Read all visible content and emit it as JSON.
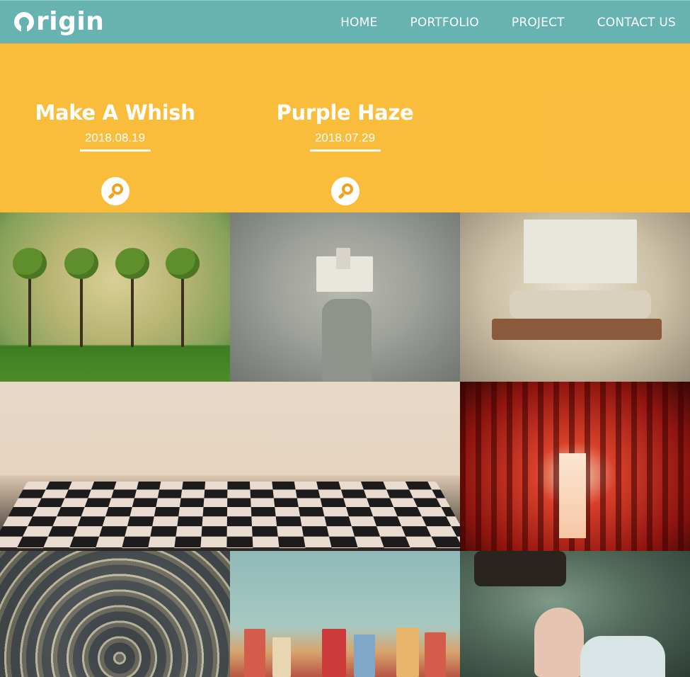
{
  "brand": {
    "logo_text": "rigin"
  },
  "nav": {
    "items": [
      {
        "label": "HOME"
      },
      {
        "label": "PORTFOLIO"
      },
      {
        "label": "PROJECT"
      },
      {
        "label": "CONTACT US"
      }
    ]
  },
  "featured": [
    {
      "title": "Make A Whish",
      "date": "2018.08.19"
    },
    {
      "title": "Purple Haze",
      "date": "2018.07.29"
    }
  ],
  "colors": {
    "header": "#67b3b1",
    "overlay": "#f3b33a",
    "accent": "#f0a21f"
  },
  "icons": {
    "search": "magnifier-icon"
  }
}
